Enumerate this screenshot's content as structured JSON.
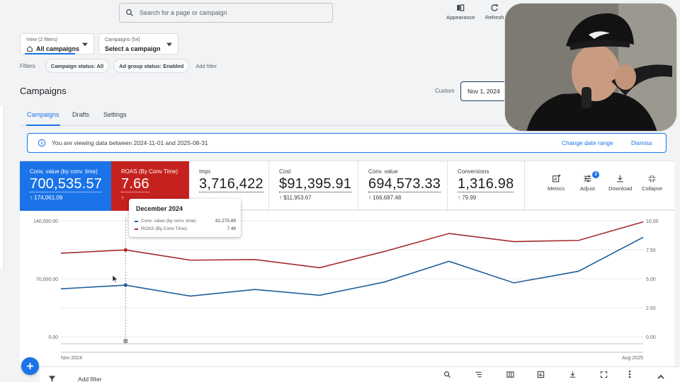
{
  "search": {
    "placeholder": "Search for a page or campaign"
  },
  "top_actions": [
    {
      "label": "Appearance",
      "icon": "appearance-icon"
    },
    {
      "label": "Refresh",
      "icon": "refresh-icon"
    }
  ],
  "view_selector": {
    "caption": "View (2 filters)",
    "value": "All campaigns"
  },
  "campaign_selector": {
    "caption": "Campaigns (54)",
    "value": "Select a campaign"
  },
  "filters": {
    "label": "Filters",
    "chips": [
      "Campaign status: All",
      "Ad group status: Enabled"
    ],
    "add_label": "Add filter"
  },
  "page": {
    "title": "Campaigns",
    "custom_label": "Custom",
    "date_start": "Nov 1, 2024"
  },
  "tabs": [
    "Campaigns",
    "Drafts",
    "Settings"
  ],
  "banner": {
    "message": "You are viewing data between 2024-11-01 and 2025-08-31",
    "change_label": "Change date range",
    "dismiss_label": "Dismiss"
  },
  "metrics": [
    {
      "label": "Conv. value (by conv. time)",
      "value": "700,535.57",
      "change": "174,061.09",
      "style": "blue"
    },
    {
      "label": "ROAS (By Conv Time)",
      "value": "7.66",
      "change": "",
      "style": "red"
    },
    {
      "label": "Impr.",
      "value": "3,716,422",
      "change": "",
      "style": "plain"
    },
    {
      "label": "Cost",
      "value": "$91,395.91",
      "change": "$11,953.67",
      "style": "plain"
    },
    {
      "label": "Conv. value",
      "value": "694,573.33",
      "change": "166,687.48",
      "style": "plain"
    },
    {
      "label": "Conversions",
      "value": "1,316.98",
      "change": "79.99",
      "style": "plain"
    }
  ],
  "tools": [
    {
      "label": "Metrics",
      "icon": "metrics-icon"
    },
    {
      "label": "Adjust",
      "icon": "adjust-icon",
      "badge": "3"
    },
    {
      "label": "Download",
      "icon": "download-icon"
    },
    {
      "label": "Collapse",
      "icon": "collapse-icon"
    }
  ],
  "tooltip": {
    "title": "December 2024",
    "rows": [
      {
        "name": "Conv. value (by conv. time)",
        "value": "62,275.89"
      },
      {
        "name": "ROAS (By Conv Time)",
        "value": "7.48"
      }
    ]
  },
  "bottom": {
    "add_filter": "Add filter"
  },
  "chart_data": {
    "type": "line",
    "x": [
      "Nov 2024",
      "Dec 2024",
      "Jan 2025",
      "Feb 2025",
      "Mar 2025",
      "Apr 2025",
      "May 2025",
      "Jun 2025",
      "Jul 2025",
      "Aug 2025"
    ],
    "x_tick_labels": [
      "Nov 2024",
      "Aug 2025"
    ],
    "y_left": {
      "ticks": [
        "140,000.00",
        "70,000.00",
        "0.00"
      ],
      "range": [
        0,
        140000
      ]
    },
    "y_right": {
      "ticks": [
        "10.00",
        "7.50",
        "5.00",
        "2.50",
        "0.00"
      ],
      "range": [
        0,
        10
      ]
    },
    "series": [
      {
        "name": "Conv. value (by conv. time)",
        "axis": "left",
        "color": "#1f5f99",
        "values": [
          57800,
          62275.89,
          49000,
          57000,
          50000,
          66000,
          91000,
          65000,
          79000,
          120000
        ]
      },
      {
        "name": "ROAS (By Conv Time)",
        "axis": "right",
        "color": "#a52a2a",
        "values": [
          7.2,
          7.48,
          6.6,
          6.65,
          5.95,
          7.35,
          8.9,
          8.2,
          8.3,
          9.9
        ]
      }
    ],
    "highlight_index": 1
  }
}
